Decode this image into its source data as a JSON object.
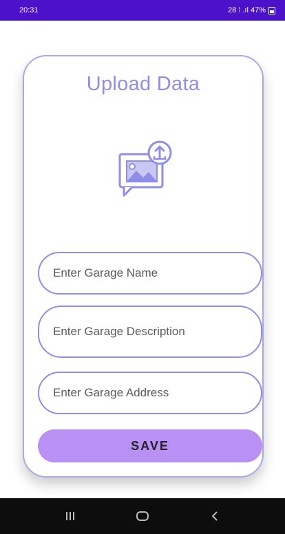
{
  "status_bar": {
    "time": "20:31",
    "indicators": "28 ⁞ .ıl 47%",
    "battery_icon": "battery-icon"
  },
  "card": {
    "title": "Upload Data",
    "upload_icon": "image-upload-icon",
    "fields": [
      {
        "placeholder": "Enter Garage Name",
        "value": ""
      },
      {
        "placeholder": "Enter Garage Description",
        "value": ""
      },
      {
        "placeholder": "Enter Garage Address",
        "value": ""
      }
    ],
    "save_label": "SAVE"
  },
  "colors": {
    "status_bar": "#4b12c9",
    "accent": "#8f8de8",
    "button": "#b990f4",
    "nav_bar": "#0d0d0d"
  },
  "nav_bar": {
    "recent_icon": "recent-apps-icon",
    "home_icon": "home-icon",
    "back_icon": "back-icon"
  }
}
